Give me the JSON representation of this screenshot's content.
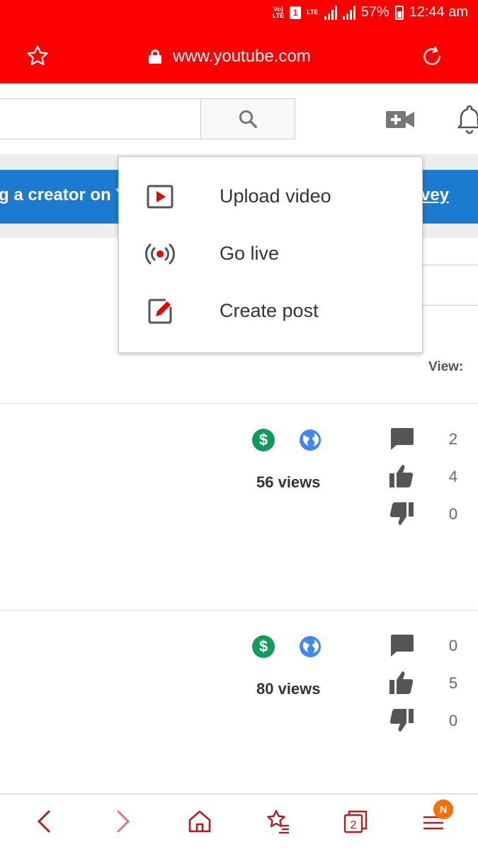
{
  "status_bar": {
    "volte": "Vo) LTE",
    "sim": "1",
    "lte": "LTE",
    "battery_percent": "57%",
    "time": "12:44 am"
  },
  "browser": {
    "url": "www.youtube.com",
    "icons": [
      "star-icon",
      "lock-icon",
      "reload-icon"
    ]
  },
  "header": {
    "search_placeholder": "",
    "icons": [
      "search-icon",
      "create-video-icon",
      "bell-icon"
    ]
  },
  "banner": {
    "text_left": "g a creator on Y",
    "link_right": "vey",
    "color": "#1a7bd0"
  },
  "filter": {
    "view_label": "View:"
  },
  "create_menu": {
    "items": [
      {
        "label": "Upload video",
        "icon": "upload-video-icon"
      },
      {
        "label": "Go live",
        "icon": "go-live-icon"
      },
      {
        "label": "Create post",
        "icon": "create-post-icon"
      }
    ]
  },
  "videos": [
    {
      "views": "56 views",
      "comments": "2",
      "likes": "4",
      "dislikes": "0"
    },
    {
      "views": "80 views",
      "comments": "0",
      "likes": "5",
      "dislikes": "0"
    }
  ],
  "bottom_nav": {
    "items": [
      "back-icon",
      "forward-icon",
      "home-icon",
      "bookmarks-icon",
      "tabs-icon",
      "menu-icon"
    ],
    "tabs_count": "2",
    "badge": "N"
  },
  "colors": {
    "brand_red": "#ff0000",
    "monetization_green": "#0f9d58",
    "public_blue": "#4285f4",
    "badge_orange": "#ff6d00"
  }
}
